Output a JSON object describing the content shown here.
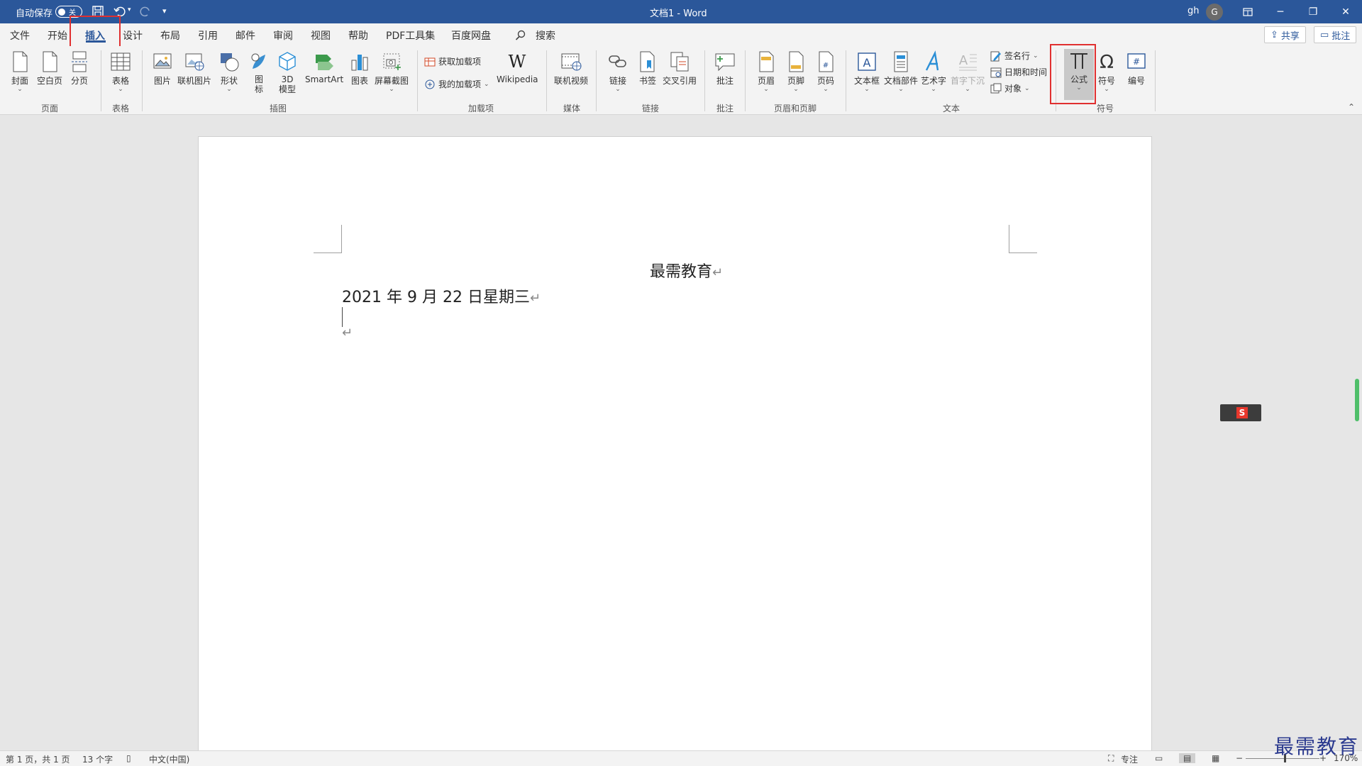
{
  "titlebar": {
    "autosave_label": "自动保存",
    "autosave_state": "关",
    "doc_title": "文档1 - Word",
    "user": "gh",
    "avatar_letter": "G"
  },
  "menu": {
    "tabs": [
      "文件",
      "开始",
      "插入",
      "设计",
      "布局",
      "引用",
      "邮件",
      "审阅",
      "视图",
      "帮助",
      "PDF工具集",
      "百度网盘"
    ],
    "active_tab": "插入",
    "search": "搜索",
    "share": "共享",
    "comments": "批注"
  },
  "ribbon": {
    "pages": {
      "cover": "封面",
      "blank": "空白页",
      "break": "分页",
      "group": "页面"
    },
    "tables": {
      "table": "表格",
      "group": "表格"
    },
    "illustrations": {
      "picture": "图片",
      "online_picture": "联机图片",
      "shapes": "形状",
      "icons": "图标",
      "model3d": "3D模型",
      "smartart": "SmartArt",
      "chart": "图表",
      "screenshot": "屏幕截图",
      "group": "插图"
    },
    "addins": {
      "get": "获取加载项",
      "mine": "我的加载项",
      "wikipedia": "Wikipedia",
      "group": "加载项"
    },
    "media": {
      "online_video": "联机视频",
      "group": "媒体"
    },
    "links": {
      "link": "链接",
      "bookmark": "书签",
      "cross_ref": "交叉引用",
      "group": "链接"
    },
    "comments": {
      "comment": "批注",
      "group": "批注"
    },
    "header_footer": {
      "header": "页眉",
      "footer": "页脚",
      "page_number": "页码",
      "group": "页眉和页脚"
    },
    "text": {
      "textbox": "文本框",
      "quickparts": "文档部件",
      "wordart": "艺术字",
      "dropcap": "首字下沉",
      "signature": "签名行",
      "datetime": "日期和时间",
      "object": "对象",
      "group": "文本"
    },
    "symbols": {
      "equation": "公式",
      "symbol": "符号",
      "numbering": "编号",
      "group": "符号"
    }
  },
  "document": {
    "title": "最需教育",
    "line1": "2021 年 9 月 22 日星期三",
    "para_mark": "↵"
  },
  "status": {
    "page": "第 1 页，共 1 页",
    "words": "13 个字",
    "language": "中文(中国)",
    "focus": "专注",
    "zoom": "170%"
  },
  "watermark": "最需教育",
  "colors": {
    "accent": "#2b579a",
    "highlight": "#e03030"
  }
}
